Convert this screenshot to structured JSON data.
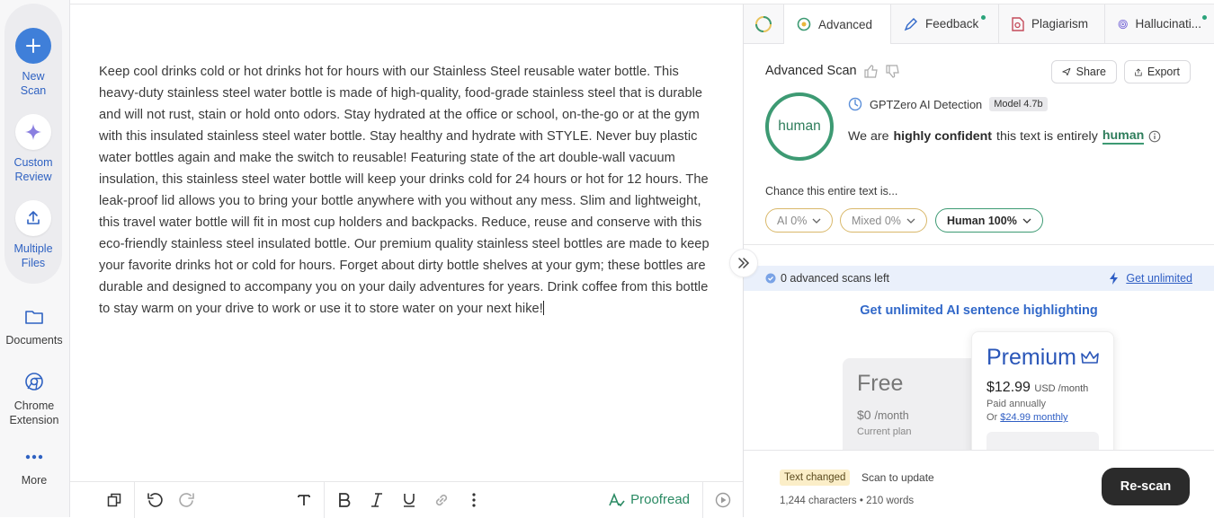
{
  "sidebar": {
    "new_scan": "New\nScan",
    "custom_review": "Custom\nReview",
    "multiple_files": "Multiple\nFiles",
    "documents": "Documents",
    "chrome_extension": "Chrome\nExtension",
    "more": "More"
  },
  "editor": {
    "text": "Keep cool drinks cold or hot drinks hot for hours with our Stainless Steel reusable water bottle. This heavy-duty stainless steel water bottle is made of high-quality, food-grade stainless steel that is durable and will not rust, stain or hold onto odors. Stay hydrated at the office or school, on-the-go or at the gym with this insulated stainless steel water bottle. Stay healthy and hydrate with STYLE. Never buy plastic water bottles again and make the switch to reusable! Featuring state of the art double-wall vacuum insulation, this stainless steel water bottle will keep your drinks cold for 24 hours or hot for 12 hours. The leak-proof lid allows you to bring your bottle anywhere with you without any mess. Slim and lightweight, this travel water bottle will fit in most cup holders and backpacks. Reduce, reuse and conserve with this eco-friendly stainless steel insulated bottle. Our premium quality stainless steel bottles are made to keep your favorite drinks hot or cold for hours. Forget about dirty bottle shelves at your gym; these bottles are durable and designed to accompany you on your daily adventures for years. Drink coffee from this bottle to stay warm on your drive to work or use it to store water on your next hike!",
    "toolbar": {
      "proofread": "Proofread"
    }
  },
  "panel": {
    "tabs": [
      {
        "label": "Advanced"
      },
      {
        "label": "Feedback"
      },
      {
        "label": "Plagiarism"
      },
      {
        "label": "Hallucinati..."
      }
    ],
    "scan_title": "Advanced Scan",
    "share": "Share",
    "export": "Export",
    "ring_label": "human",
    "detector": "GPTZero AI Detection",
    "model": "Model 4.7b",
    "verdict_pre": "We are",
    "verdict_bold": "highly confident",
    "verdict_mid": "this text is entirely",
    "verdict_class": "human",
    "chance_label": "Chance this entire text is...",
    "pills": {
      "ai": "AI 0%",
      "mixed": "Mixed 0%",
      "human": "Human 100%"
    },
    "scans_left": "0 advanced scans left",
    "get_unlimited": "Get unlimited",
    "promo": "Get unlimited AI sentence highlighting",
    "free_plan": {
      "name": "Free",
      "price": "$0",
      "period": "/month",
      "note": "Current plan"
    },
    "premium_plan": {
      "name": "Premium",
      "price": "$12.99",
      "currency": "USD /month",
      "billing": "Paid annually",
      "alt_prefix": "Or",
      "alt_link": "$24.99 monthly"
    },
    "text_changed": "Text changed",
    "scan_update": "Scan to update",
    "counts": "1,244 characters • 210 words",
    "rescan": "Re-scan"
  },
  "colors": {
    "accent_blue": "#3f7fd9",
    "human_green": "#3d9a73",
    "mixed_gold": "#d9b86a",
    "rescan_dark": "#2b2b2b"
  }
}
